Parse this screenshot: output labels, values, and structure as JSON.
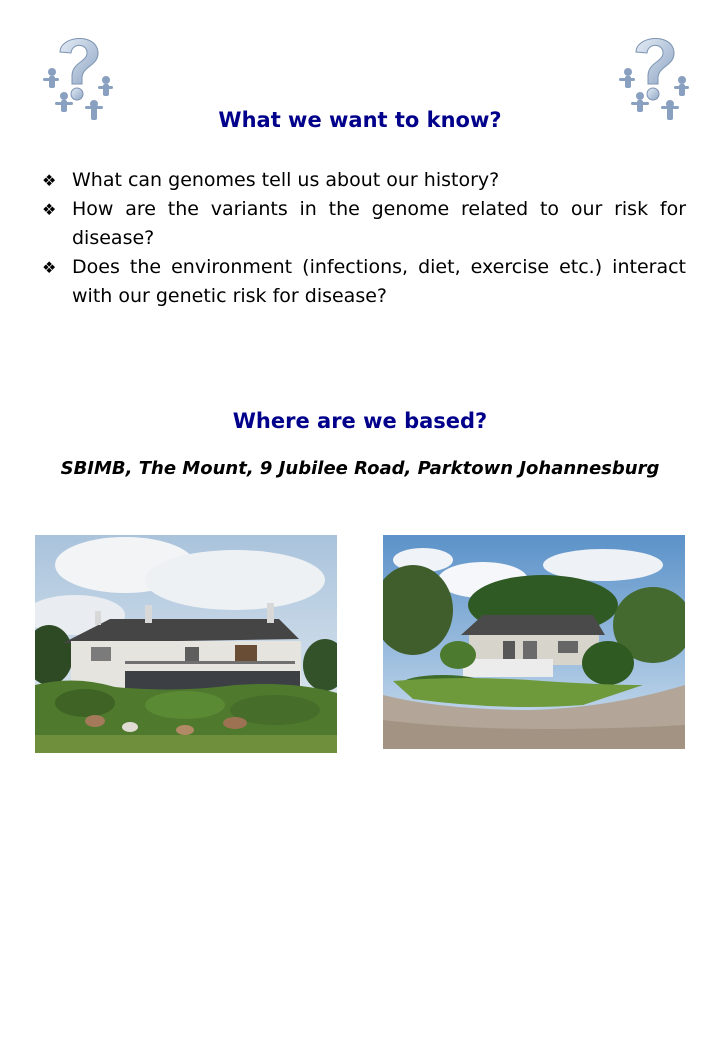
{
  "icons": {
    "top_left": "question-mark-people-icon",
    "top_right": "question-mark-people-icon",
    "bullet": "four-diamond-bullet-icon"
  },
  "section1": {
    "title": "What we want to know?",
    "bullets": [
      "What can genomes tell us about our history?",
      "How are the variants in the genome related to our risk for disease?",
      "Does the environment (infections, diet, exercise etc.) interact with our genetic risk for disease?"
    ]
  },
  "section2": {
    "title": "Where are we based?",
    "address": "SBIMB, The Mount, 9 Jubilee Road, Parktown Johannesburg"
  },
  "colors": {
    "heading": "#00008b",
    "text": "#000000",
    "background": "#ffffff"
  }
}
